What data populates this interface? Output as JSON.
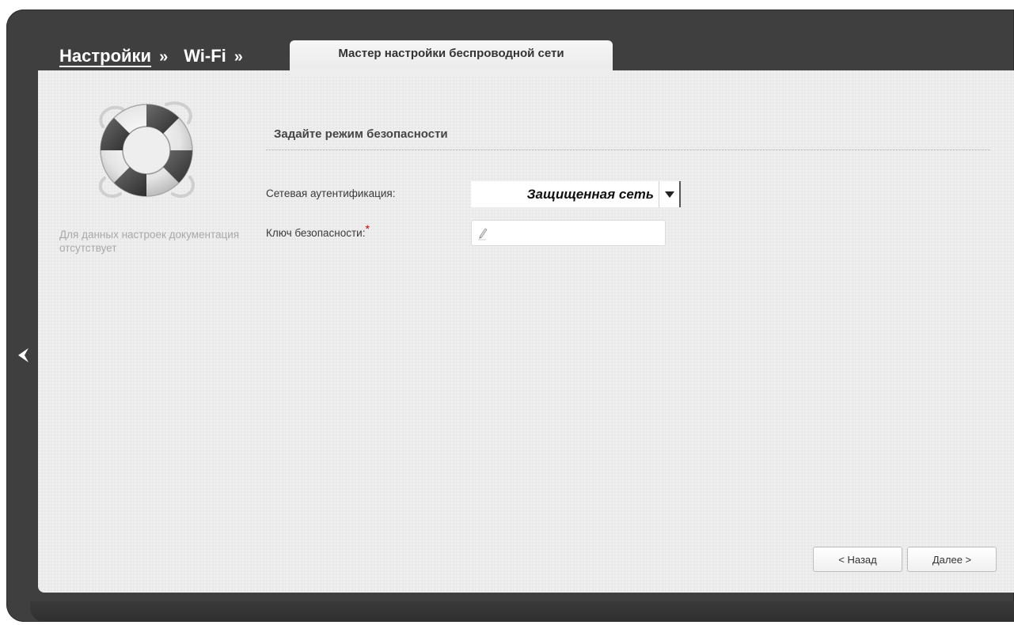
{
  "breadcrumb": {
    "items": [
      {
        "label": "Настройки"
      },
      {
        "label": "Wi-Fi"
      }
    ],
    "separator": "»"
  },
  "tab": {
    "label": "Мастер настройки беспроводной сети"
  },
  "help": {
    "icon": "lifebuoy-icon",
    "text": "Для данных настроек документация отсутствует"
  },
  "section": {
    "title": "Задайте режим безопасности"
  },
  "form": {
    "auth": {
      "label": "Сетевая аутентификация:",
      "value": "Защищенная сеть"
    },
    "key": {
      "label": "Ключ безопасности:",
      "required_mark": "*",
      "value": "",
      "icon": "pencil-icon"
    }
  },
  "buttons": {
    "back": "< Назад",
    "next": "Далее >"
  },
  "nav": {
    "collapse_icon": "chevron-left-icon"
  },
  "colors": {
    "frame": "#3f3f3f",
    "panel": "#eeeeee",
    "required": "#d40000"
  }
}
